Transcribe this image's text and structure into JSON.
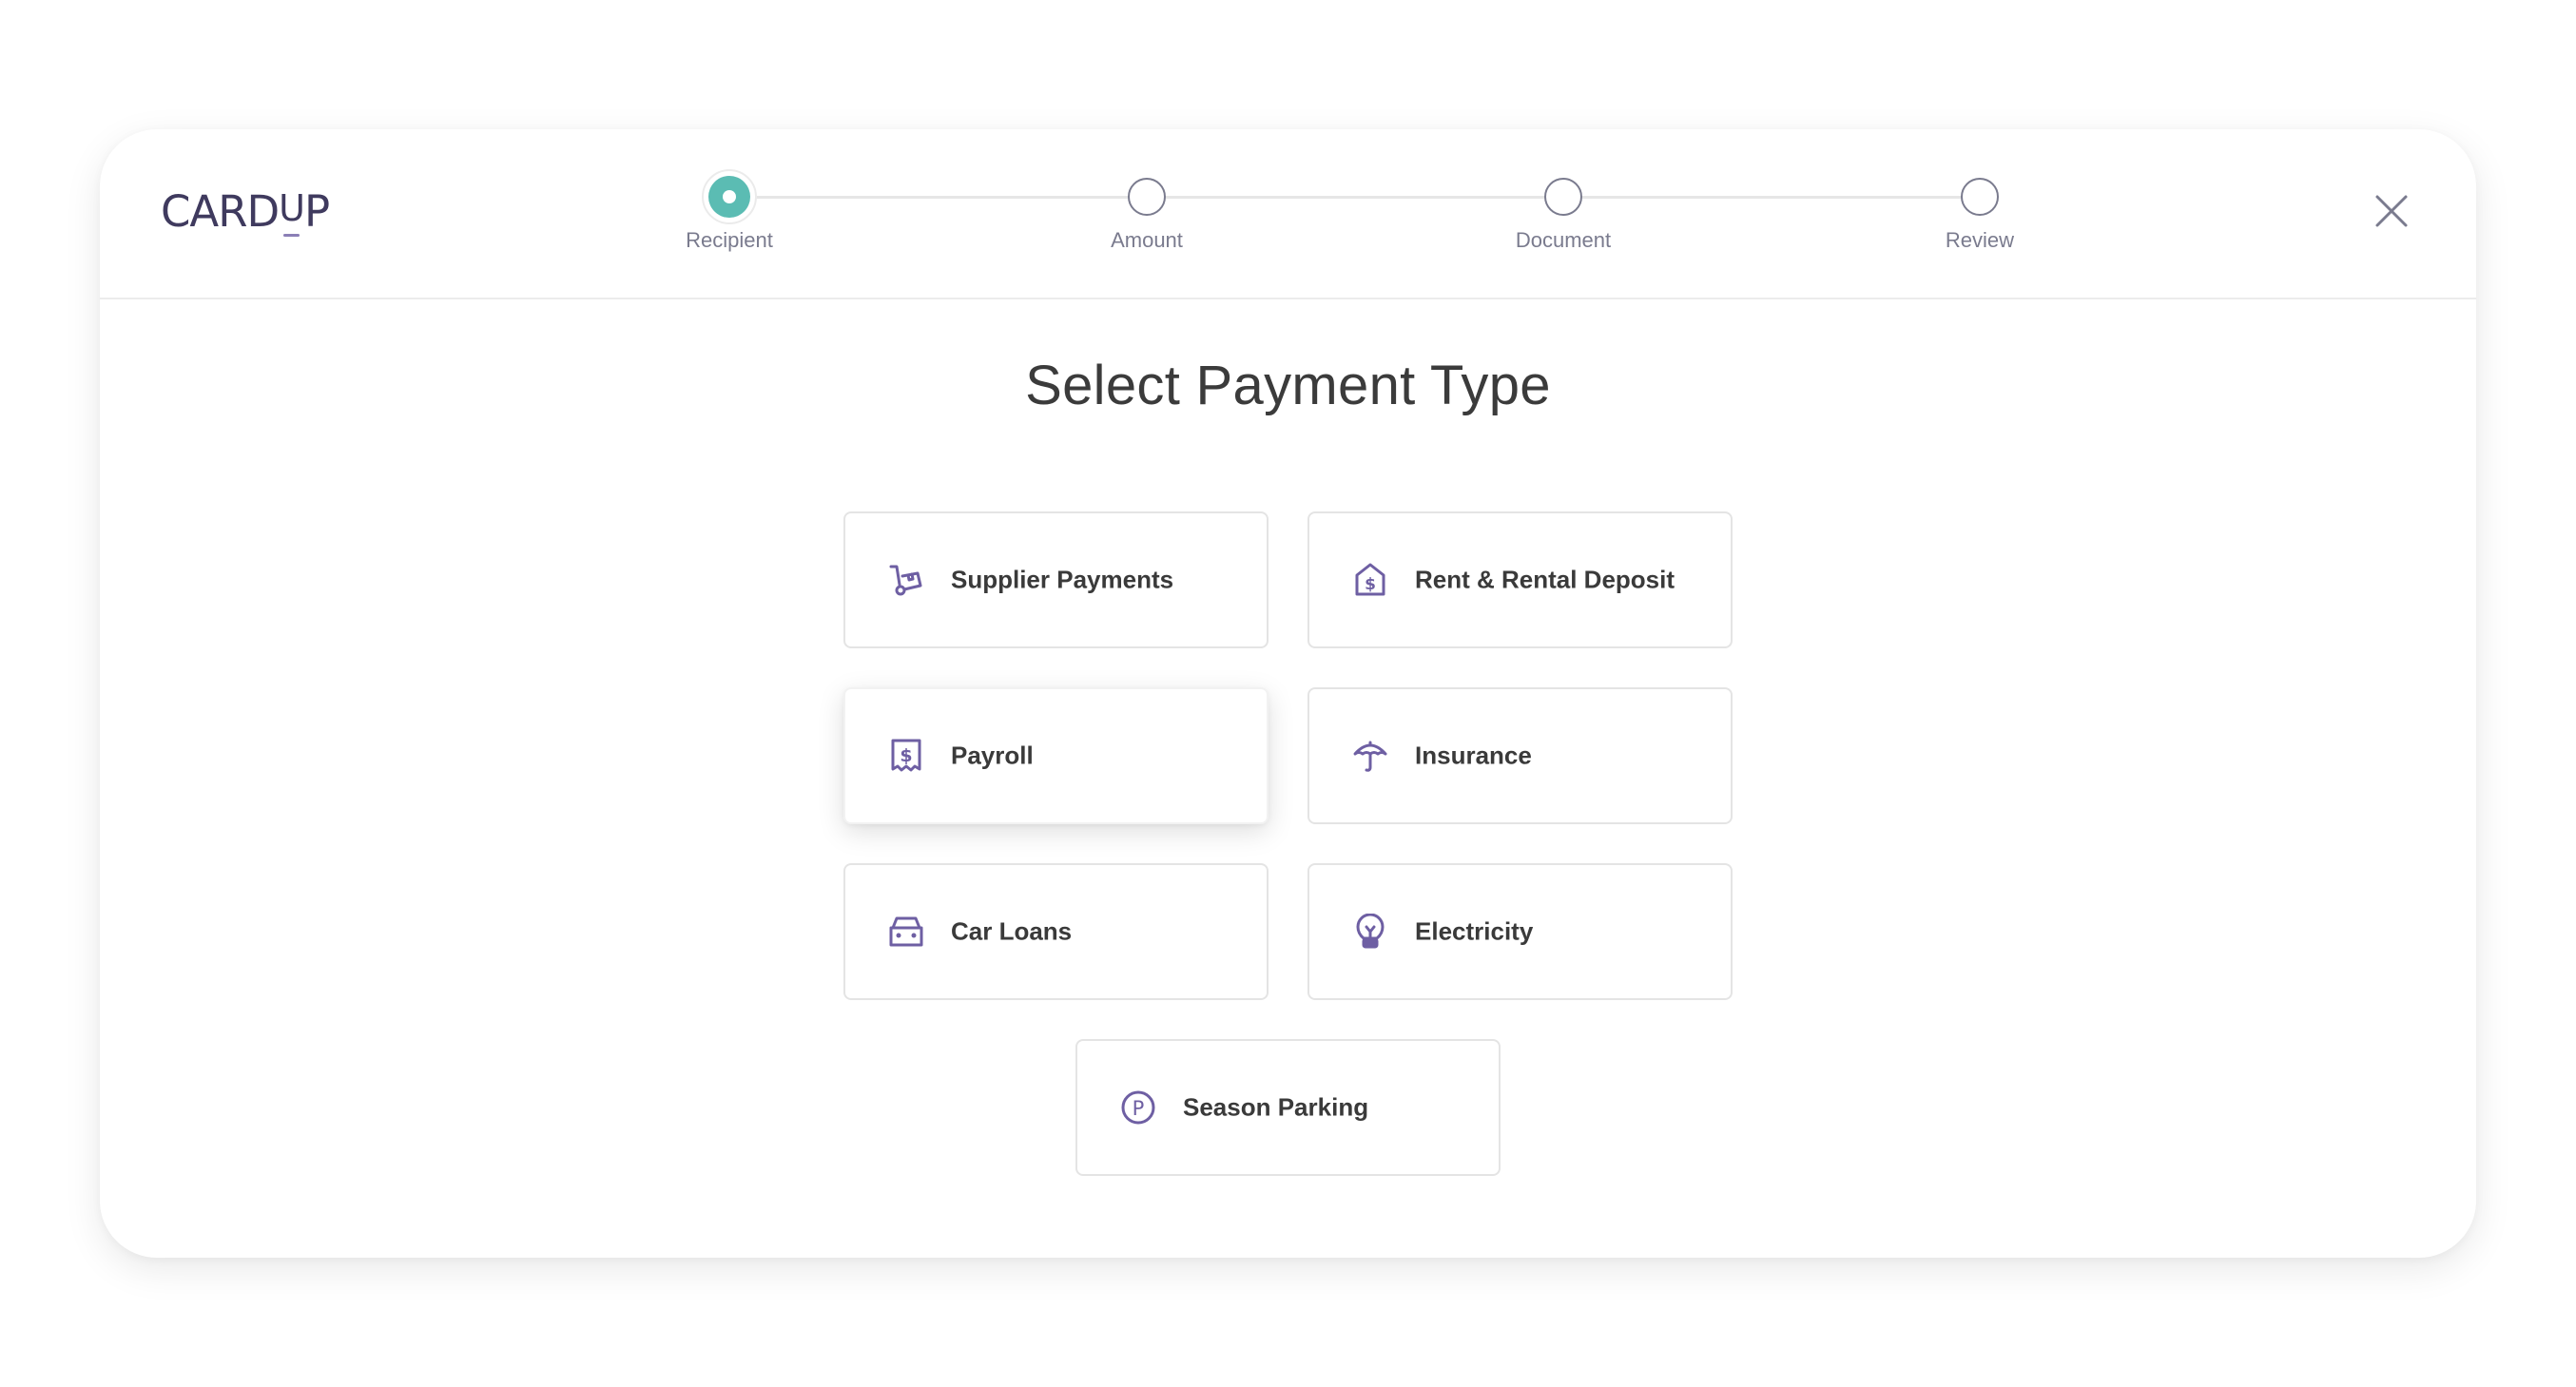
{
  "app": {
    "brand": "CARDUP",
    "brand_parts": {
      "before": "CARD",
      "underlined": "U",
      "after": "P"
    }
  },
  "stepper": {
    "steps": [
      {
        "label": "Recipient",
        "state": "active"
      },
      {
        "label": "Amount",
        "state": "pending"
      },
      {
        "label": "Document",
        "state": "pending"
      },
      {
        "label": "Review",
        "state": "pending"
      }
    ]
  },
  "header": {
    "close_icon": "close-icon"
  },
  "main": {
    "title": "Select Payment Type",
    "options": [
      {
        "label": "Supplier Payments",
        "icon": "hand-truck-icon"
      },
      {
        "label": "Rent & Rental Deposit",
        "icon": "house-dollar-icon"
      },
      {
        "label": "Payroll",
        "icon": "receipt-dollar-icon",
        "hovered": true
      },
      {
        "label": "Insurance",
        "icon": "umbrella-icon"
      },
      {
        "label": "Car Loans",
        "icon": "car-icon"
      },
      {
        "label": "Electricity",
        "icon": "lightbulb-icon"
      },
      {
        "label": "Season Parking",
        "icon": "parking-icon"
      }
    ]
  },
  "colors": {
    "accent_teal": "#5bbcb3",
    "icon_purple": "#6e5fa3",
    "brand_purple": "#3f3a5e",
    "text_dark": "#3a3a3a",
    "muted_gray": "#7a7b8e"
  }
}
